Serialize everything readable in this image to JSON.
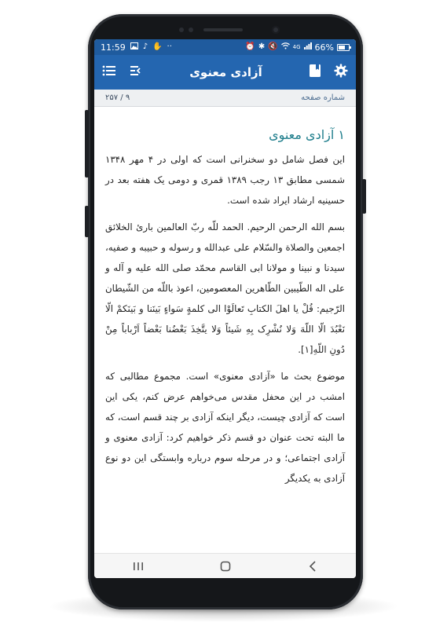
{
  "status_bar": {
    "time": "11:59",
    "battery": "66%",
    "signal_text": "4G",
    "left_icons": [
      "image-icon",
      "music-icon",
      "hand-icon",
      "more-dots-icon"
    ],
    "right_icons": [
      "alarm-icon",
      "bluetooth-icon",
      "mute-icon",
      "wifi-icon",
      "signal-icon",
      "battery-icon"
    ]
  },
  "app_bar": {
    "title": "آزادی معنوی",
    "left_icons": [
      "menu-icon",
      "toc-icon"
    ],
    "right_icons": [
      "bookmark-icon",
      "settings-gear-icon"
    ]
  },
  "page_bar": {
    "label": "شماره صفحه",
    "page_count": "۹ / ۲۵۷"
  },
  "content": {
    "heading": "۱ آزادی معنوی",
    "paragraphs": [
      "این فصل شامل دو سخنرانی است که اولی در ۴ مهر ۱۳۴۸ شمسی مطابق ۱۳ رجب ۱۳۸۹ قمری و دومی یک هفته بعد در حسینیه ارشاد ایراد شده است.",
      "بسم الله الرحمن الرحیم. الحمد للّه ربّ العالمین بارئ الخلائق اجمعین والصلاة والسّلام علی عبدالله و رسوله و حبیبه و صفیه، سیدنا و نبینا و مولانا ابی القاسم محمّد صلی الله علیه و آله و علی اله الطّیبین الطّاهرین المعصومین، اعوذ باللّه من الشّیطان الرّجیم: قُلْ یا اهلَ الکتابِ تَعالَوْا الی کلمةٍ سَواءٍ بَینَنا و بَینَکمْ الّا نَعْبُدَ الّا اللّهَ وَلا نُشْرِک بِهِ شَیئاً وَلا یتَّخِذَ بَعْضُنا بَعْضاً اَرْباباً مِنْ دُونِ اللّهِ[۱].",
      "موضوع بحث ما «آزادی معنوی» است. مجموع مطالبی که امشب در این محفل مقدس می‌خواهم عرض کنم، یکی این است که آزادی چیست، دیگر اینکه آزادی بر چند قسم است، که ما البته تحت عنوان دو قسم ذکر خواهیم کرد: آزادی معنوی و آزادی اجتماعی؛ و در مرحله سوم درباره وابستگی این دو نوع آزادی به یکدیگر"
    ]
  },
  "nav_bar": {
    "buttons": [
      "recent-apps-icon",
      "home-icon",
      "back-icon"
    ]
  },
  "colors": {
    "status_bar": "#1f5b9e",
    "app_bar": "#2466b0",
    "heading": "#1f7e8c",
    "page_bar_bg": "#eef0f2"
  }
}
